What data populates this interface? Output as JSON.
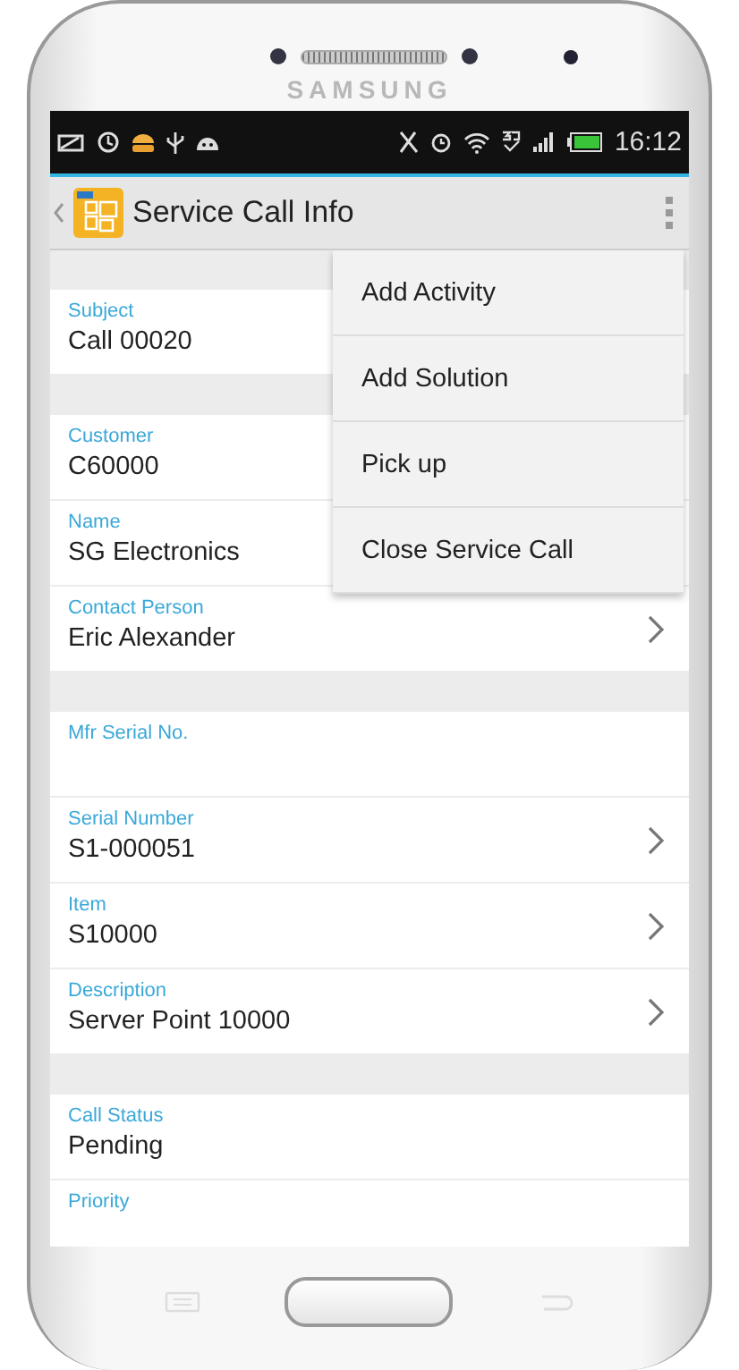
{
  "device": {
    "brand": "SAMSUNG"
  },
  "status_bar": {
    "time": "16:12"
  },
  "app_bar": {
    "title": "Service Call Info"
  },
  "sections": [
    [
      {
        "label": "Subject",
        "value": "Call 00020"
      }
    ],
    [
      {
        "label": "Customer",
        "value": "C60000"
      },
      {
        "label": "Name",
        "value": "SG Electronics"
      },
      {
        "label": "Contact Person",
        "value": "Eric Alexander",
        "chevron": true
      }
    ],
    [
      {
        "label": "Mfr Serial No.",
        "chevron": false
      },
      {
        "label": "Serial Number",
        "value": "S1-000051",
        "chevron": true
      },
      {
        "label": "Item",
        "value": "S10000",
        "chevron": true
      },
      {
        "label": "Description",
        "value": "Server Point 10000",
        "chevron": true
      }
    ],
    [
      {
        "label": "Call Status",
        "value": "Pending",
        "chevron": false
      },
      {
        "label": "Priority",
        "chevron": false
      }
    ]
  ],
  "menu": {
    "open": true,
    "items": [
      "Add Activity",
      "Add Solution",
      "Pick up",
      "Close Service Call"
    ]
  }
}
